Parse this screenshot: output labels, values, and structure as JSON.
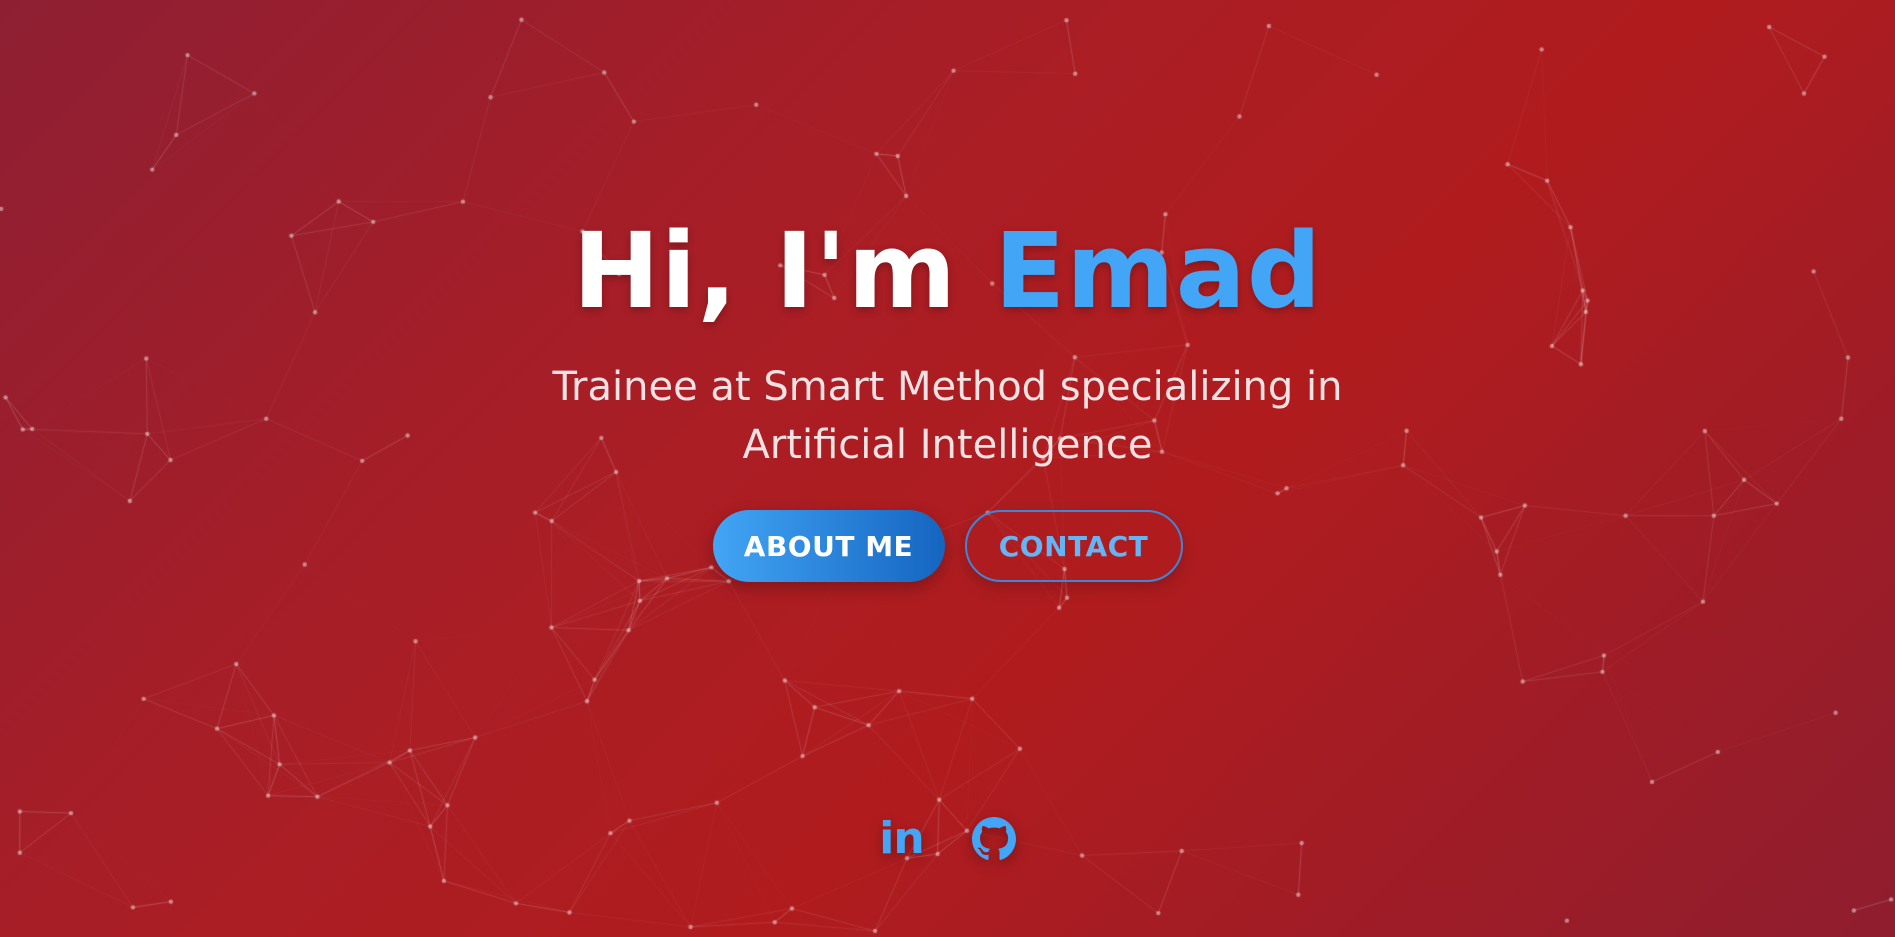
{
  "hero": {
    "greeting": "Hi, I'm",
    "name": "Emad",
    "subtitle": "Trainee at Smart Method specializing in Artificial Intelligence"
  },
  "buttons": {
    "about_label": "ABOUT ME",
    "contact_label": "CONTACT"
  },
  "socials": [
    {
      "icon": "linkedin-icon",
      "text": "in"
    },
    {
      "icon": "github-icon"
    }
  ],
  "colors": {
    "accent": "#42a5f5",
    "background_start": "#8e1f33",
    "background_mid": "#b01c1e"
  }
}
